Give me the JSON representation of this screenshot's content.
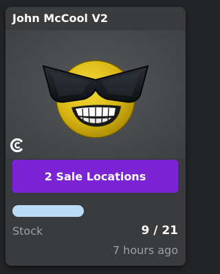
{
  "card": {
    "title": "John McCool V2",
    "sale_button_label": "2 Sale Locations",
    "stock_label": "Stock",
    "stock_value": "9 / 21",
    "time_ago": "7 hours ago"
  },
  "icons": {
    "creator_badge": "creator-logo-icon",
    "item_art": "cool-face-with-sunglasses"
  },
  "colors": {
    "page_bg": "#222426",
    "card_bg": "#393b3d",
    "button": "#7b24d3",
    "stock_bar": "#bcdcf6",
    "muted_text": "#9ea0a2"
  }
}
